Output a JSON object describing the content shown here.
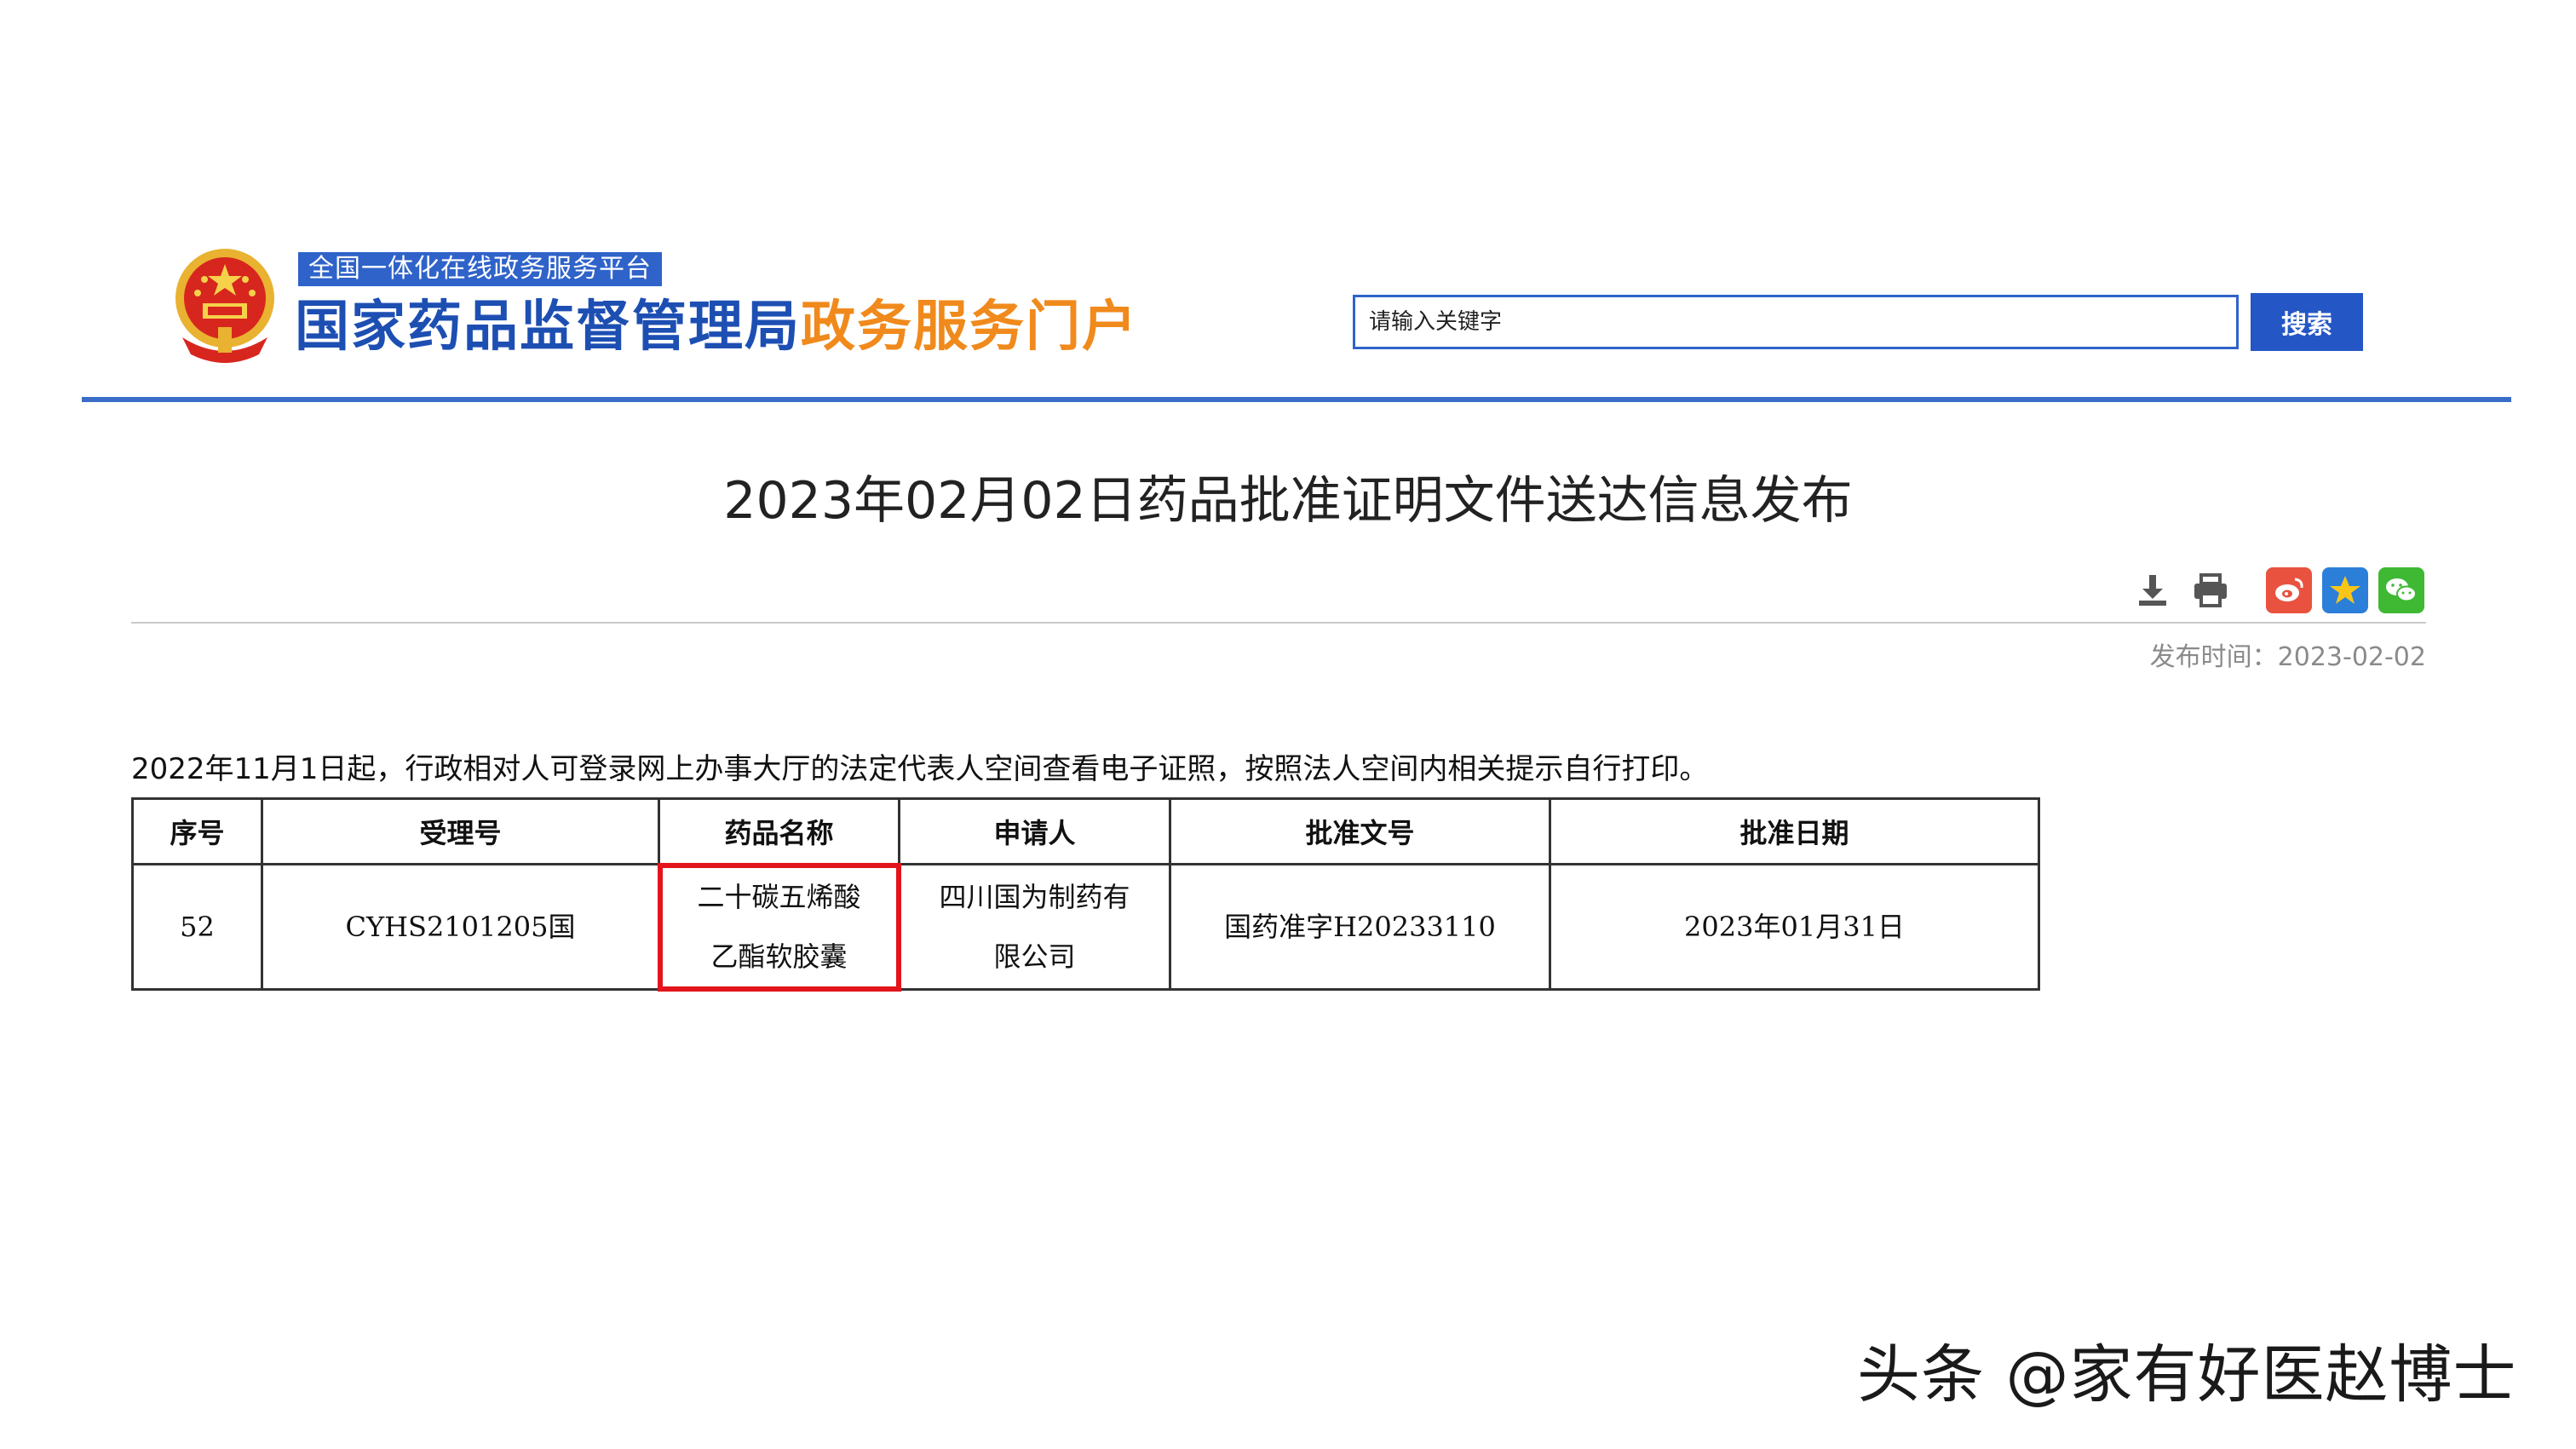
{
  "header": {
    "platform_tag": "全国一体化在线政务服务平台",
    "title_blue": "国家药品监督管理局",
    "title_orange": "政务服务门户",
    "search_placeholder": "请输入关键字",
    "search_button": "搜索",
    "colors": {
      "brand_blue": "#1d4fb3",
      "brand_orange": "#f08a1c",
      "rule_blue": "#3a6dc8"
    }
  },
  "article": {
    "title": "2023年02月02日药品批准证明文件送达信息发布",
    "publish_time": "发布时间：2023-02-02",
    "toolbar_icons": [
      "download-icon",
      "print-icon",
      "weibo-share-icon",
      "qzone-share-icon",
      "wechat-share-icon"
    ],
    "notice": "2022年11月1日起，行政相对人可登录网上办事大厅的法定代表人空间查看电子证照，按照法人空间内相关提示自行打印。"
  },
  "table": {
    "headers": [
      "序号",
      "受理号",
      "药品名称",
      "申请人",
      "批准文号",
      "批准日期"
    ],
    "rows": [
      {
        "seq": "52",
        "acceptance_no": "CYHS2101205国",
        "drug_name_line1": "二十碳五烯酸",
        "drug_name_line2": "乙酯软胶囊",
        "applicant_line1": "四川国为制药有",
        "applicant_line2": "限公司",
        "approval_no": "国药准字H20233110",
        "approval_date": "2023年01月31日"
      }
    ],
    "highlight_color": "#e3141b"
  },
  "watermark": "头条 @家有好医赵博士"
}
